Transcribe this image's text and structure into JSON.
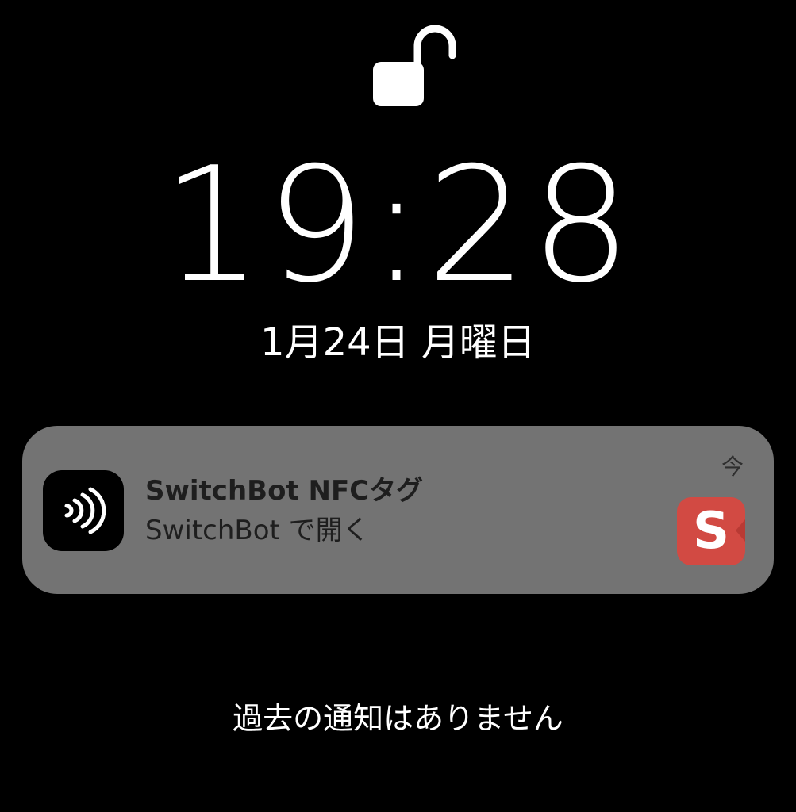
{
  "lock_screen": {
    "lock_icon": "unlocked-padlock-icon",
    "time": "19:28",
    "date": "1月24日 月曜日"
  },
  "notification": {
    "app_icon": "nfc-contactless-icon",
    "title": "SwitchBot NFCタグ",
    "body": "SwitchBot で開く",
    "time": "今",
    "attachment_icon": "switchbot-app-icon",
    "attachment_letter": "S",
    "colors": {
      "background": "#737373",
      "attachment": "#d24a43"
    }
  },
  "footer": {
    "message": "過去の通知はありません"
  }
}
